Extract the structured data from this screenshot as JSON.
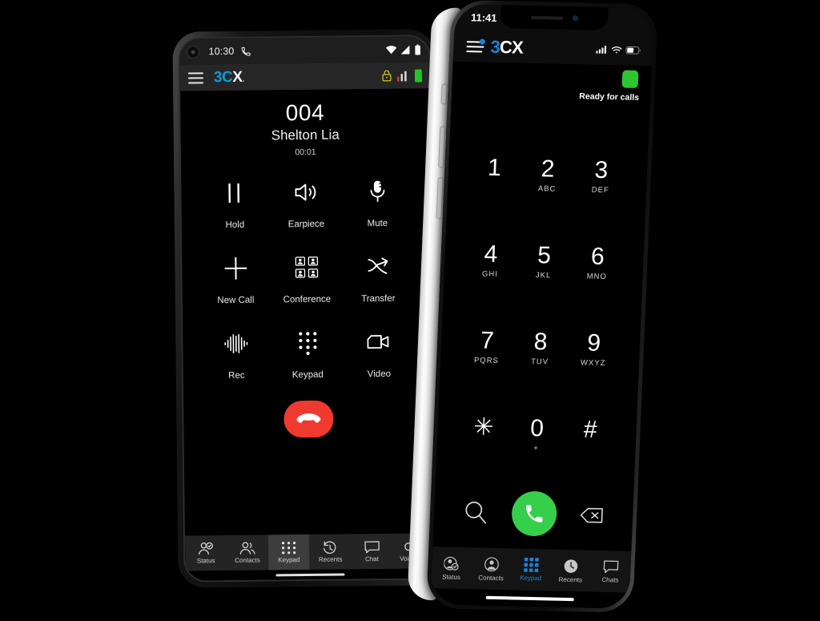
{
  "android": {
    "status_bar": {
      "time": "10:30",
      "call_icon": "phone-handset-icon",
      "wifi_icon": "wifi-icon",
      "signal_icon": "cellular-signal-icon",
      "battery_icon": "battery-icon"
    },
    "app_bar": {
      "menu_icon": "hamburger-menu-icon",
      "logo_blue": "3C",
      "logo_white": "X",
      "logo_dot": ".",
      "lock_icon": "lock-icon",
      "lock_color": "#d4c518",
      "quality_icon": "call-quality-bars-icon",
      "quality_bar_alert_color": "#e0392c",
      "battery_status_icon": "battery-full-icon",
      "battery_status_color": "#23c723"
    },
    "call": {
      "number": "004",
      "name": "Shelton Lia",
      "duration": "00:01"
    },
    "controls": [
      {
        "label": "Hold",
        "icon": "pause-icon"
      },
      {
        "label": "Earpiece",
        "icon": "speaker-icon"
      },
      {
        "label": "Mute",
        "icon": "microphone-icon"
      },
      {
        "label": "New Call",
        "icon": "plus-icon"
      },
      {
        "label": "Conference",
        "icon": "conference-icon"
      },
      {
        "label": "Transfer",
        "icon": "transfer-arrow-icon"
      },
      {
        "label": "Rec",
        "icon": "waveform-record-icon"
      },
      {
        "label": "Keypad",
        "icon": "dialpad-icon"
      },
      {
        "label": "Video",
        "icon": "video-camera-icon"
      }
    ],
    "end_call": {
      "icon": "end-call-icon",
      "color": "#f0392f"
    },
    "tabs": [
      {
        "label": "Status",
        "icon": "status-person-icon",
        "selected": false
      },
      {
        "label": "Contacts",
        "icon": "contacts-icon",
        "selected": false
      },
      {
        "label": "Keypad",
        "icon": "dialpad-icon",
        "selected": true
      },
      {
        "label": "Recents",
        "icon": "clock-history-icon",
        "selected": false
      },
      {
        "label": "Chat",
        "icon": "chat-bubble-icon",
        "selected": false
      },
      {
        "label": "Voicemail",
        "icon": "voicemail-icon",
        "selected": false
      }
    ]
  },
  "iphone": {
    "status_bar": {
      "time": "11:41",
      "signal_icon": "cellular-signal-icon",
      "wifi_icon": "wifi-icon",
      "battery_icon": "battery-icon"
    },
    "app_bar": {
      "menu_icon": "hamburger-menu-icon",
      "logo_blue": "3",
      "logo_white": "CX"
    },
    "presence": {
      "status_color": "#2dc72d",
      "status_text": "Ready for calls"
    },
    "dialpad": [
      {
        "digit": "1",
        "sub": ""
      },
      {
        "digit": "2",
        "sub": "ABC"
      },
      {
        "digit": "3",
        "sub": "DEF"
      },
      {
        "digit": "4",
        "sub": "GHI"
      },
      {
        "digit": "5",
        "sub": "JKL"
      },
      {
        "digit": "6",
        "sub": "MNO"
      },
      {
        "digit": "7",
        "sub": "PQRS"
      },
      {
        "digit": "8",
        "sub": "TUV"
      },
      {
        "digit": "9",
        "sub": "WXYZ"
      },
      {
        "digit": "✳",
        "sub": ""
      },
      {
        "digit": "0",
        "sub": "+"
      },
      {
        "digit": "#",
        "sub": ""
      }
    ],
    "actions": {
      "search_icon": "search-icon",
      "call_icon": "call-icon",
      "call_color": "#35cf4b",
      "backspace_icon": "backspace-icon"
    },
    "tabs": [
      {
        "label": "Status",
        "icon": "status-person-icon",
        "selected": false
      },
      {
        "label": "Contacts",
        "icon": "contacts-icon",
        "selected": false
      },
      {
        "label": "Keypad",
        "icon": "dialpad-icon",
        "selected": true
      },
      {
        "label": "Recents",
        "icon": "clock-history-icon",
        "selected": false
      },
      {
        "label": "Chats",
        "icon": "chat-bubble-icon",
        "selected": false
      }
    ]
  }
}
